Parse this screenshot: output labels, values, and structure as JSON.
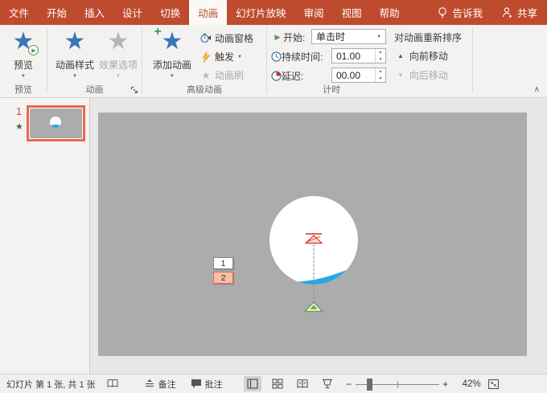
{
  "menubar": {
    "tabs": [
      "文件",
      "开始",
      "插入",
      "设计",
      "切换",
      "动画",
      "幻灯片放映",
      "审阅",
      "视图",
      "帮助"
    ],
    "active_tab": "动画",
    "tell_me": "告诉我",
    "share": "共享"
  },
  "ribbon": {
    "preview": {
      "group_label": "预览",
      "button": "预览"
    },
    "animation": {
      "group_label": "动画",
      "styles_button": "动画样式",
      "effects_button": "效果选项"
    },
    "advanced": {
      "group_label": "高级动画",
      "add_button": "添加动画",
      "pane_button": "动画窗格",
      "trigger_button": "触发",
      "painter_button": "动画刷"
    },
    "timing": {
      "group_label": "计时",
      "start_label": "开始:",
      "start_value": "单击时",
      "duration_label": "持续时间:",
      "duration_value": "01.00",
      "delay_label": "延迟:",
      "delay_value": "00.00",
      "reorder_label": "对动画重新排序",
      "move_earlier": "向前移动",
      "move_later": "向后移动"
    }
  },
  "slide_panel": {
    "slide_number": "1"
  },
  "slide": {
    "badges": [
      "1",
      "2"
    ]
  },
  "statusbar": {
    "slide_indicator": "幻灯片 第 1 张, 共 1 张",
    "notes_label": "备注",
    "comments_label": "批注",
    "zoom_level": "42%"
  },
  "icons": {
    "star": "★",
    "play": "▶",
    "dropdown": "▼",
    "spin_up": "▲",
    "spin_down": "▼",
    "move_up_arrow": "▲",
    "move_down_arrow": "▼",
    "zoom_out": "−",
    "zoom_in": "+",
    "collapse_chevron": "∧",
    "plus": "+"
  },
  "colors": {
    "accent": "#BF4B2E",
    "star_blue": "#3A76B7",
    "water_blue": "#29A8E0",
    "selection_orange": "#E8674B",
    "path_red": "#D93025",
    "path_green": "#6AA84F"
  }
}
